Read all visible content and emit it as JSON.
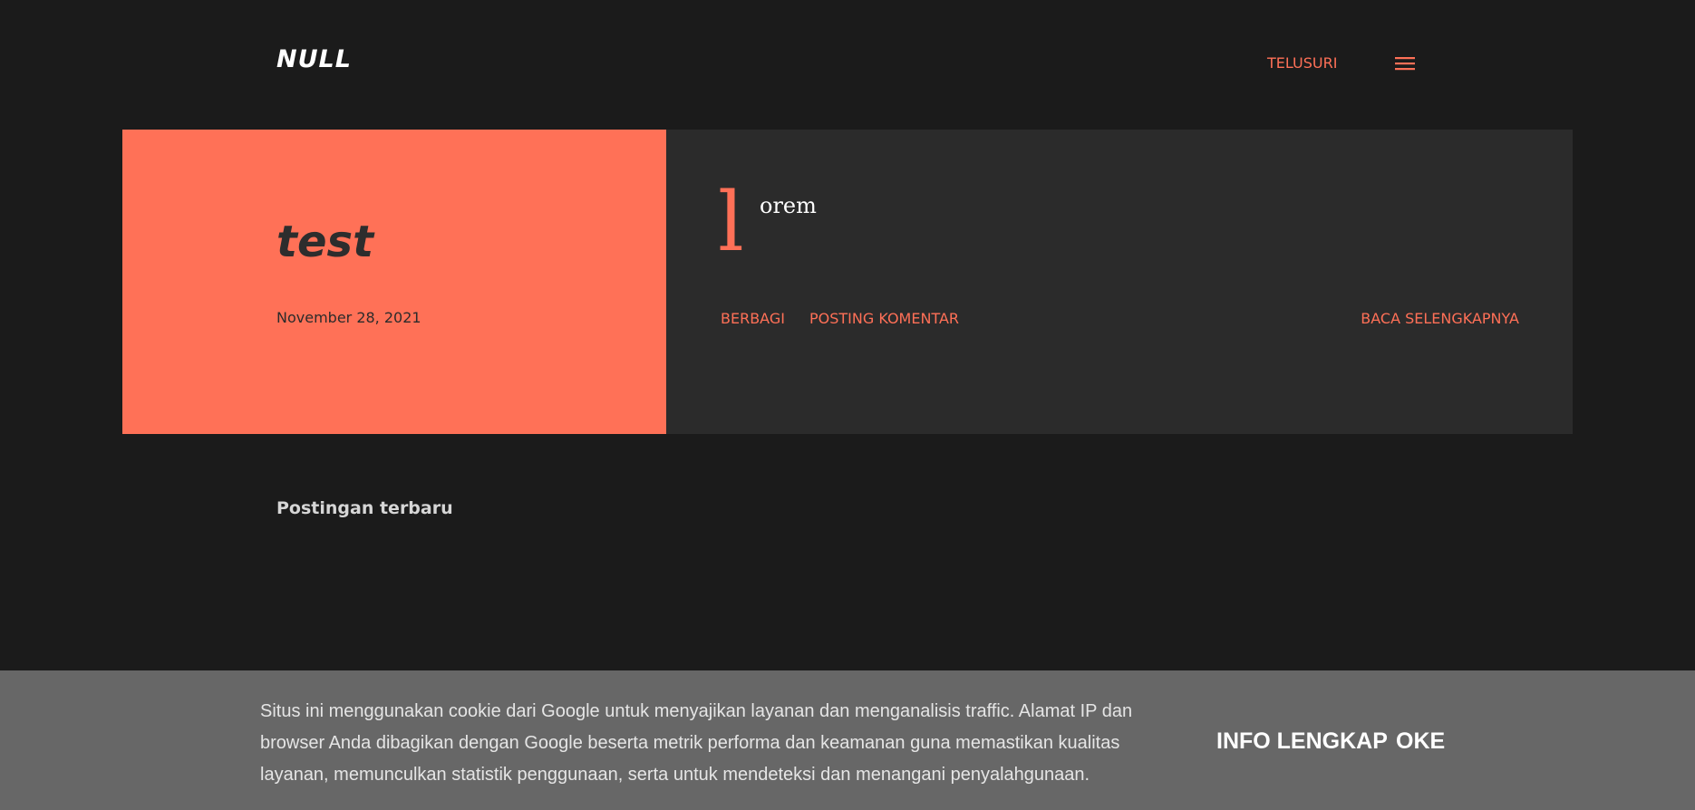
{
  "header": {
    "site_title": "NULL",
    "search_label": "TELUSURI",
    "menu_icon": "hamburger-menu-icon"
  },
  "post": {
    "title": "test",
    "date": "November 28, 2021",
    "snippet_dropcap": "l",
    "snippet_rest": "orem",
    "share_label": "BERBAGI",
    "comment_label": "POSTING KOMENTAR",
    "read_more_label": "BACA SELENGKAPNYA"
  },
  "recent": {
    "heading": "Postingan terbaru"
  },
  "cookie": {
    "message": "Situs ini menggunakan cookie dari Google untuk menyajikan layanan dan menganalisis traffic. Alamat IP dan browser Anda dibagikan dengan Google beserta metrik performa dan keamanan guna memastikan kualitas layanan, memunculkan statistik penggunaan, serta untuk mendeteksi dan menangani penyalahgunaan.",
    "info_label": "INFO LENGKAP",
    "ok_label": "OKE"
  },
  "colors": {
    "background": "#1b1b1b",
    "accent": "#ff7157",
    "card_dark": "#2b2b2b",
    "cookie_bar": "#676767"
  }
}
